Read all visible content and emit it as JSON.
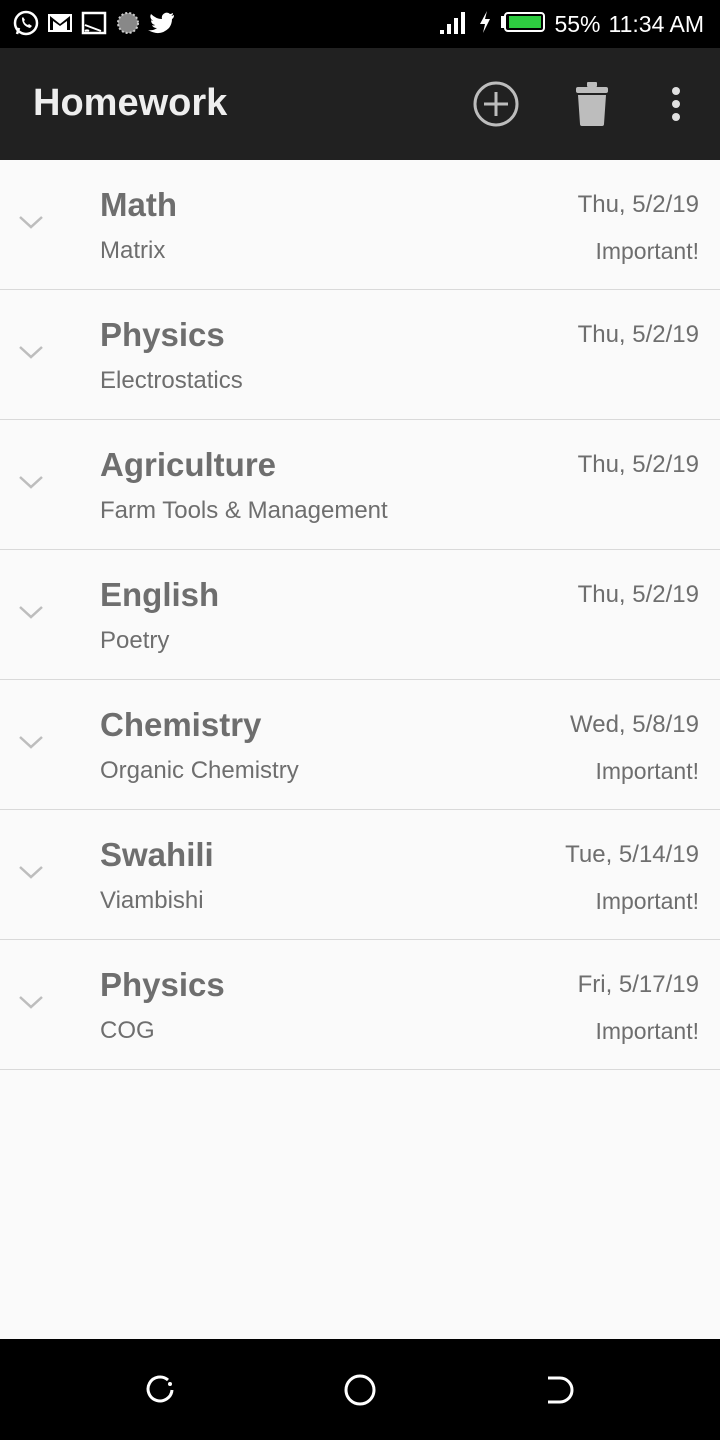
{
  "status_bar": {
    "icons_left": [
      "whatsapp-icon",
      "gmail-icon",
      "cast-icon",
      "loading-icon",
      "twitter-icon"
    ],
    "battery": "55%",
    "time": "11:34 AM"
  },
  "app_bar": {
    "title": "Homework",
    "actions": [
      "add-circle-icon",
      "trash-icon",
      "more-vert-icon"
    ]
  },
  "homework": [
    {
      "subject": "Math",
      "topic": "Matrix",
      "date": "Thu, 5/2/19",
      "flag": "Important!"
    },
    {
      "subject": "Physics",
      "topic": "Electrostatics",
      "date": "Thu, 5/2/19",
      "flag": ""
    },
    {
      "subject": "Agriculture",
      "topic": "Farm Tools & Management",
      "date": "Thu, 5/2/19",
      "flag": ""
    },
    {
      "subject": "English",
      "topic": "Poetry",
      "date": "Thu, 5/2/19",
      "flag": ""
    },
    {
      "subject": "Chemistry",
      "topic": "Organic Chemistry",
      "date": "Wed, 5/8/19",
      "flag": "Important!"
    },
    {
      "subject": "Swahili",
      "topic": "Viambishi",
      "date": "Tue, 5/14/19",
      "flag": "Important!"
    },
    {
      "subject": "Physics",
      "topic": "COG",
      "date": "Fri, 5/17/19",
      "flag": "Important!"
    }
  ],
  "colors": {
    "app_bar": "#212121",
    "background": "#fafafa",
    "text": "#6e6e6e",
    "divider": "#d9d9d9",
    "battery_fill": "#2ecc40"
  }
}
